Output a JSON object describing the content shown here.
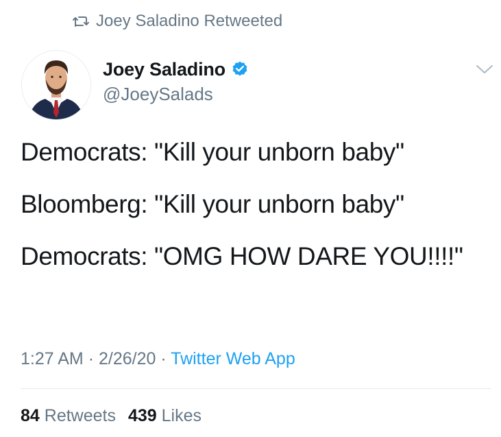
{
  "retweet_context": {
    "icon": "retweet-icon",
    "text": "Joey Saladino Retweeted"
  },
  "tweet": {
    "author": {
      "display_name": "Joey Saladino",
      "handle": "@JoeySalads",
      "verified": true,
      "avatar_icon": "avatar"
    },
    "menu_icon": "chevron-down-icon",
    "text_lines": [
      "Democrats: \"Kill your unborn baby\"",
      "Bloomberg: \"Kill your unborn baby\"",
      "Democrats: \"OMG HOW DARE YOU!!!!\""
    ],
    "time": "1:27 AM",
    "date": "2/26/20",
    "separator": "·",
    "source": "Twitter Web App",
    "stats": {
      "retweets_count": "84",
      "retweets_label": "Retweets",
      "likes_count": "439",
      "likes_label": "Likes"
    }
  },
  "colors": {
    "text": "#14171a",
    "secondary": "#657786",
    "link": "#1da1f2",
    "verified": "#1da1f2",
    "divider": "#e1e8ed"
  }
}
